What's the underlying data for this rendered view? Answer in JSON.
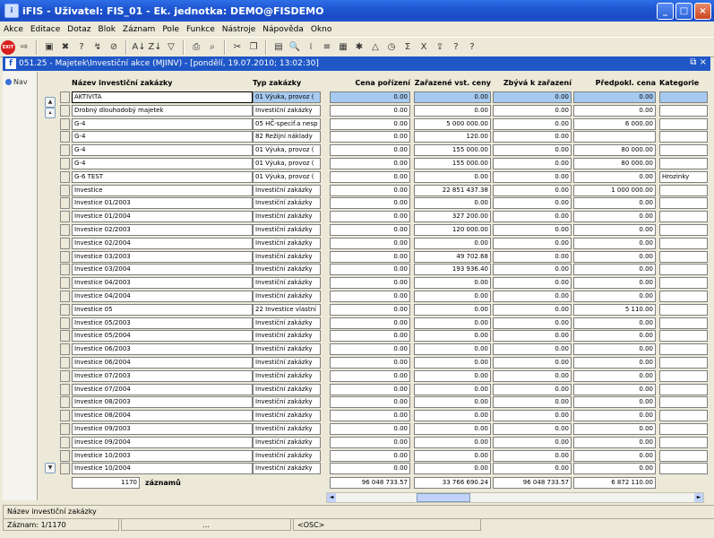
{
  "title_bar": {
    "title": "iFIS - Uživatel: FIS_01 - Ek. jednotka: DEMO@FISDEMO",
    "app_icon": "ifis-icon"
  },
  "menu": [
    "Akce",
    "Editace",
    "Dotaz",
    "Blok",
    "Záznam",
    "Pole",
    "Funkce",
    "Nástroje",
    "Nápověda",
    "Okno"
  ],
  "toolbar_icons": [
    "exit-icon",
    "insert-icon",
    "save-icon",
    "delete-icon",
    "query-icon",
    "query-run-icon",
    "query-cancel-icon",
    "sort-asc-icon",
    "sort-desc-icon",
    "filter-icon",
    "print-icon",
    "print-preview-icon",
    "cut-icon",
    "copy-icon",
    "paste-icon",
    "find-icon",
    "columns-icon",
    "rows-icon",
    "calc-icon",
    "settings-icon",
    "chart-icon",
    "clock-icon",
    "sum-icon",
    "excel-icon",
    "export-icon",
    "help-icon",
    "context-help-icon"
  ],
  "form": {
    "title": "051.25 - Majetek\\Investiční akce (MJINV) - [pondělí, 19.07.2010; 13:02:30]",
    "nav_label": "Nav",
    "headers": [
      "Název investiční zakázky",
      "Typ zakázky",
      "Cena pořízení",
      "Zařazené vst. ceny",
      "Zbývá k zařazení",
      "Předpokl. cena",
      "Kategorie"
    ],
    "rows": [
      [
        "AKTIVITA",
        "01 Výuka, provoz (",
        "0.00",
        "0.00",
        "0.00",
        "0.00",
        ""
      ],
      [
        "Drobný dlouhodobý majetek",
        "Investiční zakázky",
        "0.00",
        "0.00",
        "0.00",
        "0.00",
        ""
      ],
      [
        "G-4",
        "05 HČ-specif.a nesp",
        "0.00",
        "5 000 000.00",
        "0.00",
        "6 000.00",
        ""
      ],
      [
        "G-4",
        "82 Režijní náklady",
        "0.00",
        "120.00",
        "0.00",
        "",
        ""
      ],
      [
        "G-4",
        "01 Výuka, provoz (",
        "0.00",
        "155 000.00",
        "0.00",
        "80 000.00",
        ""
      ],
      [
        "G-4",
        "01 Výuka, provoz (",
        "0.00",
        "155 000.00",
        "0.00",
        "80 000.00",
        ""
      ],
      [
        "G-6 TEST",
        "01 Výuka, provoz (",
        "0.00",
        "0.00",
        "0.00",
        "0.00",
        "Hrozinky"
      ],
      [
        "Investice",
        "Investiční zakázky",
        "0.00",
        "22 851 437.38",
        "0.00",
        "1 000 000.00",
        ""
      ],
      [
        "Investice 01/2003",
        "Investiční zakázky",
        "0.00",
        "0.00",
        "0.00",
        "0.00",
        ""
      ],
      [
        "Investice 01/2004",
        "Investiční zakázky",
        "0.00",
        "327 200.00",
        "0.00",
        "0.00",
        ""
      ],
      [
        "Investice 02/2003",
        "Investiční zakázky",
        "0.00",
        "120 000.00",
        "0.00",
        "0.00",
        ""
      ],
      [
        "Investice 02/2004",
        "Investiční zakázky",
        "0.00",
        "0.00",
        "0.00",
        "0.00",
        ""
      ],
      [
        "Investice 03/2003",
        "Investiční zakázky",
        "0.00",
        "49 702.68",
        "0.00",
        "0.00",
        ""
      ],
      [
        "Investice 03/2004",
        "Investiční zakázky",
        "0.00",
        "193 936.40",
        "0.00",
        "0.00",
        ""
      ],
      [
        "Investice 04/2003",
        "Investiční zakázky",
        "0.00",
        "0.00",
        "0.00",
        "0.00",
        ""
      ],
      [
        "Investice 04/2004",
        "Investiční zakázky",
        "0.00",
        "0.00",
        "0.00",
        "0.00",
        ""
      ],
      [
        "Investice 05",
        "22 Investice vlastní",
        "0.00",
        "0.00",
        "0.00",
        "5 110.00",
        ""
      ],
      [
        "Investice 05/2003",
        "Investiční zakázky",
        "0.00",
        "0.00",
        "0.00",
        "0.00",
        ""
      ],
      [
        "Investice 05/2004",
        "Investiční zakázky",
        "0.00",
        "0.00",
        "0.00",
        "0.00",
        ""
      ],
      [
        "Investice 06/2003",
        "Investiční zakázky",
        "0.00",
        "0.00",
        "0.00",
        "0.00",
        ""
      ],
      [
        "Investice 06/2004",
        "Investiční zakázky",
        "0.00",
        "0.00",
        "0.00",
        "0.00",
        ""
      ],
      [
        "Investice 07/2003",
        "Investiční zakázky",
        "0.00",
        "0.00",
        "0.00",
        "0.00",
        ""
      ],
      [
        "Investice 07/2004",
        "Investiční zakázky",
        "0.00",
        "0.00",
        "0.00",
        "0.00",
        ""
      ],
      [
        "Investice 08/2003",
        "Investiční zakázky",
        "0.00",
        "0.00",
        "0.00",
        "0.00",
        ""
      ],
      [
        "Investice 08/2004",
        "Investiční zakázky",
        "0.00",
        "0.00",
        "0.00",
        "0.00",
        ""
      ],
      [
        "Investice 09/2003",
        "Investiční zakázky",
        "0.00",
        "0.00",
        "0.00",
        "0.00",
        ""
      ],
      [
        "Investice 09/2004",
        "Investiční zakázky",
        "0.00",
        "0.00",
        "0.00",
        "0.00",
        ""
      ],
      [
        "Investice 10/2003",
        "Investiční zakázky",
        "0.00",
        "0.00",
        "0.00",
        "0.00",
        ""
      ],
      [
        "Investice 10/2004",
        "Investiční zakázky",
        "0.00",
        "0.00",
        "0.00",
        "0.00",
        ""
      ]
    ],
    "record_count": "1170",
    "record_count_label": "záznamů",
    "totals": [
      "96 048 733.57",
      "33 766 690.24",
      "96 048 733.57",
      "6 872 110.00"
    ],
    "selected_color": "#a6caf0"
  },
  "status": {
    "hint": "Název investiční zakázky",
    "record": "Záznam: 1/1170",
    "dots": "...",
    "mode": "<OSC>"
  }
}
